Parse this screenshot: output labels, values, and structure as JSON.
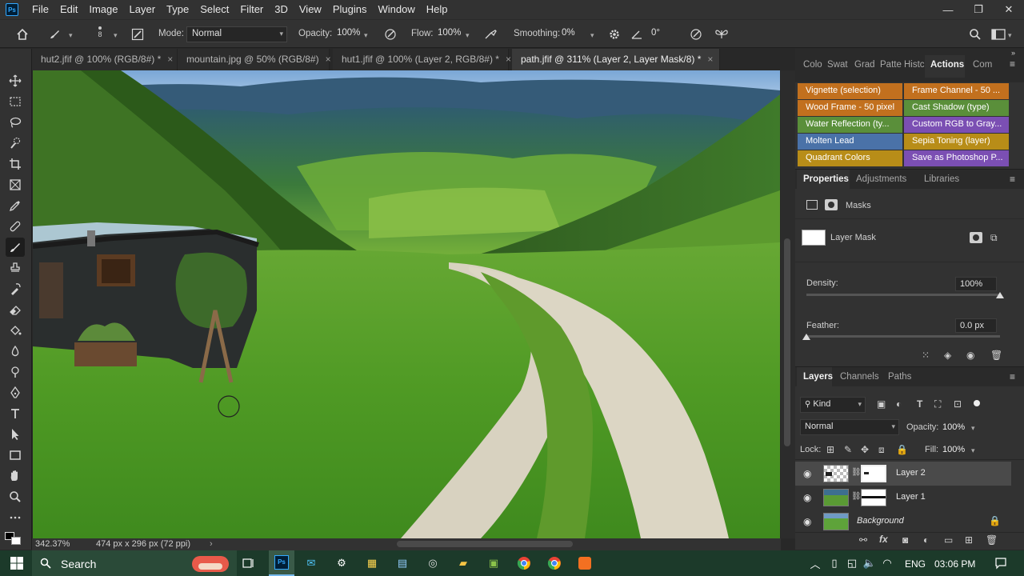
{
  "app": {
    "logo_text": "Ps",
    "menu": [
      "File",
      "Edit",
      "Image",
      "Layer",
      "Type",
      "Select",
      "Filter",
      "3D",
      "View",
      "Plugins",
      "Window",
      "Help"
    ],
    "window_controls": {
      "minimize": "—",
      "restore": "❐",
      "close": "✕"
    }
  },
  "options_bar": {
    "brush_size": "8",
    "mode_label": "Mode:",
    "mode_value": "Normal",
    "opacity_label": "Opacity:",
    "opacity_value": "100%",
    "flow_label": "Flow:",
    "flow_value": "100%",
    "smoothing_label": "Smoothing:",
    "smoothing_value": "0%",
    "angle_value": "0°"
  },
  "tabs": [
    {
      "label": "hut2.jfif @ 100% (RGB/8#) *",
      "active": false
    },
    {
      "label": "mountain.jpg @ 50% (RGB/8#)",
      "active": false
    },
    {
      "label": "hut1.jfif @ 100% (Layer 2, RGB/8#) *",
      "active": false
    },
    {
      "label": "path.jfif @ 311% (Layer 2, Layer Mask/8) *",
      "active": true
    }
  ],
  "tab_close": "×",
  "status": {
    "zoom": "342.37%",
    "doc_info": "474 px x 296 px (72 ppi)",
    "arrow": "›"
  },
  "panel_tabs_top": [
    "Colo",
    "Swat",
    "Grad",
    "Patte",
    "Histc",
    "Actions",
    "Com"
  ],
  "panel_tabs_top_active": "Actions",
  "actions": [
    {
      "label": "Vignette (selection)",
      "color": "#c2701e"
    },
    {
      "label": "Frame Channel - 50 ...",
      "color": "#c2701e"
    },
    {
      "label": "Wood Frame - 50 pixel",
      "color": "#c2701e"
    },
    {
      "label": "Cast Shadow (type)",
      "color": "#5a8f3a"
    },
    {
      "label": "Water Reflection (ty...",
      "color": "#5a8f3a"
    },
    {
      "label": "Custom RGB to Gray...",
      "color": "#7b4fb3"
    },
    {
      "label": "Molten Lead",
      "color": "#4a72a8"
    },
    {
      "label": "Sepia Toning (layer)",
      "color": "#b88d18"
    },
    {
      "label": "Quadrant Colors",
      "color": "#b88d18"
    },
    {
      "label": "Save as Photoshop P...",
      "color": "#7b4fb3"
    }
  ],
  "properties_tabs": [
    "Properties",
    "Adjustments",
    "Libraries"
  ],
  "properties": {
    "masks_label": "Masks",
    "layer_mask_label": "Layer Mask",
    "density_label": "Density:",
    "density_value": "100%",
    "density_level": 1.0,
    "feather_label": "Feather:",
    "feather_value": "0.0 px",
    "feather_level": 0.0
  },
  "layers_tabs": [
    "Layers",
    "Channels",
    "Paths"
  ],
  "layers_panel": {
    "kind_label": "Kind",
    "blend_mode": "Normal",
    "opacity_label": "Opacity:",
    "opacity_value": "100%",
    "lock_label": "Lock:",
    "fill_label": "Fill:",
    "fill_value": "100%",
    "layers": [
      {
        "name": "Layer 2",
        "selected": true
      },
      {
        "name": "Layer 1",
        "selected": false
      },
      {
        "name": "Background",
        "selected": false
      }
    ],
    "fx_label": "fx"
  },
  "taskbar": {
    "search_label": "Search",
    "language": "ENG",
    "time": "03:06 PM"
  }
}
